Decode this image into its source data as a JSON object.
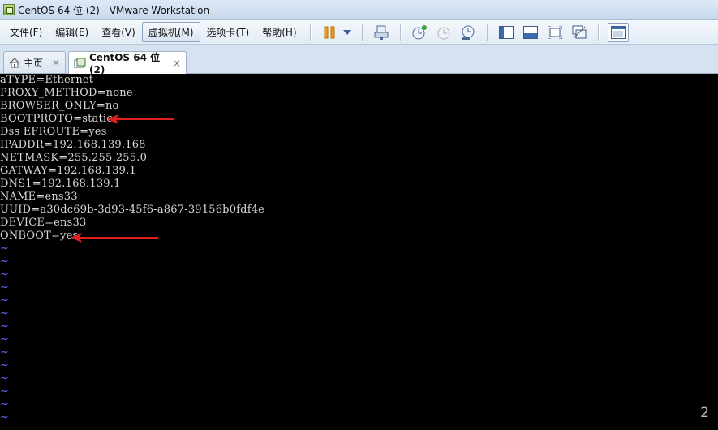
{
  "window": {
    "title": "CentOS 64 位 (2) - VMware Workstation"
  },
  "menu": {
    "items": [
      "文件(F)",
      "编辑(E)",
      "查看(V)",
      "虚拟机(M)",
      "选项卡(T)",
      "帮助(H)"
    ]
  },
  "toolbar": {
    "icons": [
      "pause-icon",
      "dropdown-arrow-icon",
      "send-ctrl-alt-del-icon",
      "snapshot-take-icon",
      "snapshot-revert-icon",
      "snapshot-manager-icon",
      "view-sidebar-icon",
      "view-console-icon",
      "full-screen-icon",
      "unity-icon",
      "view-thumbnail-icon"
    ]
  },
  "tabs": [
    {
      "label": "主页",
      "icon": "home-icon",
      "close": "×"
    },
    {
      "label": "CentOS 64 位 (2)",
      "icon": "vm-icon",
      "close": "×"
    }
  ],
  "console": {
    "lines": [
      "aTYPE=Ethernet",
      "PROXY_METHOD=none",
      "BROWSER_ONLY=no",
      "BOOTPROTO=static",
      "Dss EFROUTE=yes",
      "IPADDR=192.168.139.168",
      "NETMASK=255.255.255.0",
      "GATWAY=192.168.139.1",
      "DNS1=192.168.139.1",
      "NAME=ens33",
      "UUID=a30dc69b-3d93-45f6-a867-39156b0fdf4e",
      "DEVICE=ens33",
      "ONBOOT=yes"
    ],
    "tilde": "~",
    "tilde_count": 14,
    "annotation_color": "#e02020",
    "corner_number": "2"
  }
}
